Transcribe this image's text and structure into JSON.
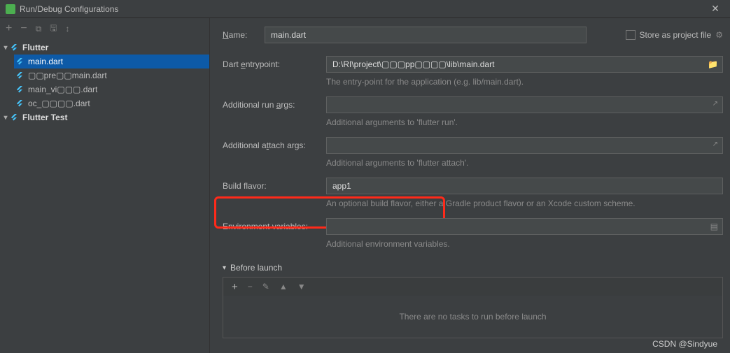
{
  "window": {
    "title": "Run/Debug Configurations"
  },
  "sidebar": {
    "groups": [
      {
        "label": "Flutter",
        "expanded": true,
        "children": [
          {
            "label": "main.dart",
            "selected": true
          },
          {
            "label": "▢▢pre▢▢main.dart"
          },
          {
            "label": "main_vi▢▢▢.dart"
          },
          {
            "label": "oc_▢▢▢▢.dart"
          }
        ]
      },
      {
        "label": "Flutter Test",
        "expanded": true,
        "children": []
      }
    ]
  },
  "form": {
    "name": {
      "label": "Name:",
      "value": "main.dart"
    },
    "storeAsProject": "Store as project file",
    "entrypoint": {
      "label": "Dart entrypoint:",
      "value": "D:\\RI\\project\\▢▢▢pp▢▢▢▢\\lib\\main.dart",
      "hint": "The entry-point for the application (e.g. lib/main.dart)."
    },
    "runArgs": {
      "label": "Additional run args:",
      "value": "",
      "hint": "Additional arguments to 'flutter run'."
    },
    "attachArgs": {
      "label": "Additional attach args:",
      "value": "",
      "hint": "Additional arguments to 'flutter attach'."
    },
    "buildFlavor": {
      "label": "Build flavor:",
      "value": "app1",
      "hint": "An optional build flavor, either a Gradle product flavor or an Xcode custom scheme."
    },
    "envVars": {
      "label": "Environment variables:",
      "value": "",
      "hint": "Additional environment variables."
    },
    "beforeLaunch": {
      "label": "Before launch",
      "empty": "There are no tasks to run before launch"
    }
  },
  "watermark": "CSDN @Sindyue"
}
